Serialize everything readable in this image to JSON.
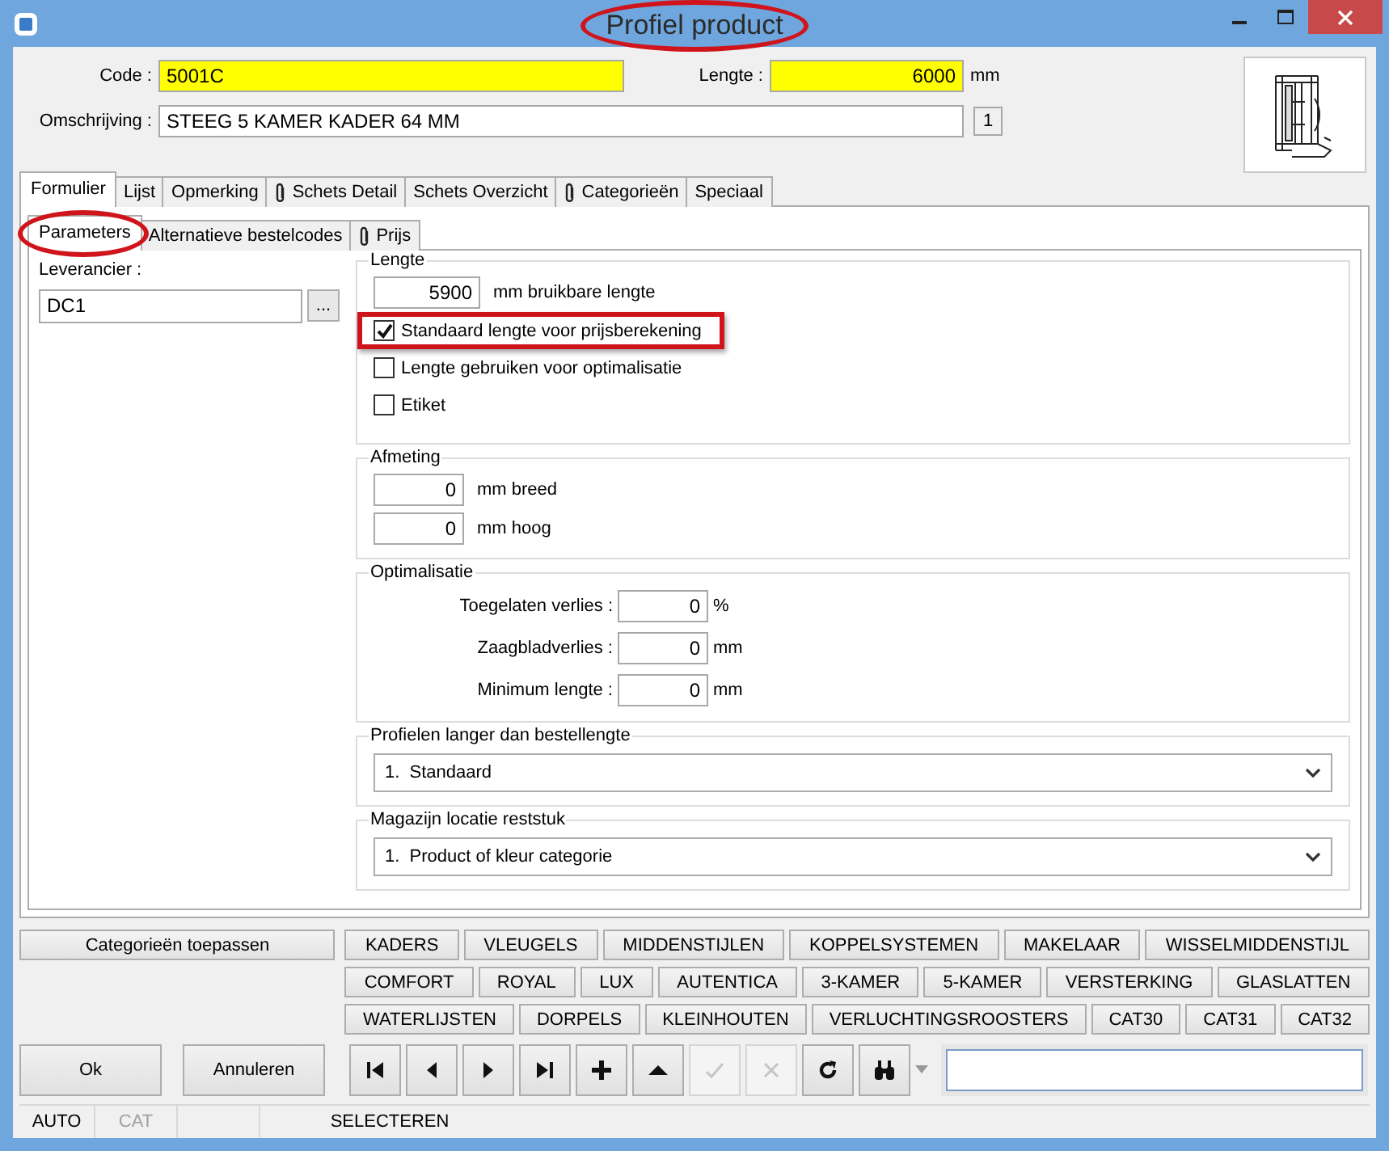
{
  "window": {
    "title": "Profiel product",
    "circled": true
  },
  "header": {
    "code_label": "Code :",
    "code": "5001C",
    "length_label": "Lengte :",
    "length": "6000",
    "length_unit": "mm",
    "description_label": "Omschrijving :",
    "description": "STEEG 5 KAMER KADER 64 MM",
    "counter": "1"
  },
  "tabs": [
    {
      "label": "Formulier",
      "selected": true,
      "attachment": false
    },
    {
      "label": "Lijst",
      "selected": false,
      "attachment": false
    },
    {
      "label": "Opmerking",
      "selected": false,
      "attachment": false
    },
    {
      "label": "Schets Detail",
      "selected": false,
      "attachment": true
    },
    {
      "label": "Schets Overzicht",
      "selected": false,
      "attachment": false
    },
    {
      "label": "Categorieën",
      "selected": false,
      "attachment": true
    },
    {
      "label": "Speciaal",
      "selected": false,
      "attachment": false
    }
  ],
  "subtabs": [
    {
      "label": "Parameters",
      "selected": true,
      "attachment": false,
      "circled": true
    },
    {
      "label": "Alternatieve bestelcodes",
      "selected": false,
      "attachment": false,
      "circled": false
    },
    {
      "label": "Prijs",
      "selected": false,
      "attachment": true,
      "circled": false
    }
  ],
  "supplier": {
    "label": "Leverancier :",
    "value": "DC1",
    "browse": "..."
  },
  "length_group": {
    "title": "Lengte",
    "value": "5900",
    "unit": "mm bruikbare lengte",
    "options": [
      {
        "label": "Standaard lengte voor prijsberekening",
        "checked": true,
        "highlighted": true
      },
      {
        "label": "Lengte gebruiken voor optimalisatie",
        "checked": false,
        "highlighted": false
      },
      {
        "label": "Etiket",
        "checked": false,
        "highlighted": false
      }
    ]
  },
  "dimension_group": {
    "title": "Afmeting",
    "fields": [
      {
        "value": "0",
        "unit": "mm breed"
      },
      {
        "value": "0",
        "unit": "mm hoog"
      }
    ]
  },
  "optimisation_group": {
    "title": "Optimalisatie",
    "fields": [
      {
        "label": "Toegelaten verlies :",
        "value": "0",
        "unit": "%"
      },
      {
        "label": "Zaagbladverlies :",
        "value": "0",
        "unit": "mm"
      },
      {
        "label": "Minimum lengte :",
        "value": "0",
        "unit": "mm"
      }
    ]
  },
  "dropdowns": [
    {
      "title": "Profielen langer dan bestellengte",
      "value": "1.  Standaard"
    },
    {
      "title": "Magazijn locatie reststuk",
      "value": "1.  Product of kleur categorie"
    }
  ],
  "categories": {
    "apply": "Categorieën toepassen",
    "groups": [
      {
        "buttons": [
          "KADERS",
          "VLEUGELS",
          "MIDDENSTIJLEN",
          "KOPPELSYSTEMEN",
          "MAKELAAR",
          "WISSELMIDDENSTIJL"
        ]
      },
      {
        "buttons": [
          "COMFORT",
          "ROYAL",
          "LUX",
          "AUTENTICA",
          "3-KAMER",
          "5-KAMER",
          "VERSTERKING",
          "GLASLATTEN"
        ]
      },
      {
        "buttons": [
          "WATERLIJSTEN",
          "DORPELS",
          "KLEINHOUTEN",
          "VERLUCHTINGSROOSTERS",
          "CAT30",
          "CAT31",
          "CAT32"
        ]
      }
    ]
  },
  "toolbar": {
    "ok": "Ok",
    "cancel": "Annuleren",
    "tools": [
      {
        "kind": "first",
        "disabled": false
      },
      {
        "kind": "prev",
        "disabled": false
      },
      {
        "kind": "next",
        "disabled": false
      },
      {
        "kind": "last",
        "disabled": false
      },
      {
        "kind": "add",
        "disabled": false
      },
      {
        "kind": "up",
        "disabled": false
      },
      {
        "kind": "confirm",
        "disabled": true
      },
      {
        "kind": "cancel",
        "disabled": true
      },
      {
        "kind": "refresh",
        "disabled": false
      },
      {
        "kind": "find",
        "disabled": false
      }
    ]
  },
  "status_bar": [
    {
      "text": "AUTO",
      "disabled": false
    },
    {
      "text": "CAT",
      "disabled": true
    },
    {
      "text": "SELECTEREN",
      "disabled": false
    }
  ]
}
